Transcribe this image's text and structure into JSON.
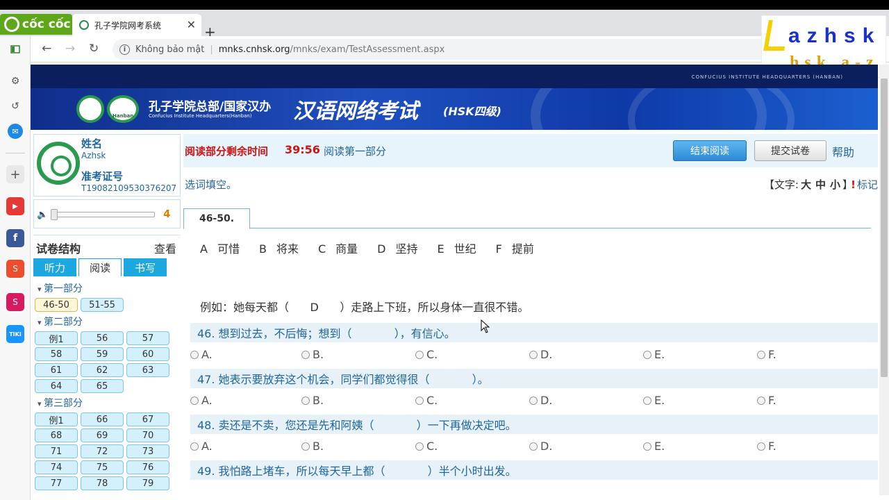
{
  "browser": {
    "brand": "cốc cốc",
    "tab_title": "孔子学院网考系统",
    "security_label": "Không bảo mật",
    "url_host": "mnks.cnhsk.org",
    "url_path": "/mnks/exam/TestAssessment.aspx"
  },
  "watermark": {
    "top": "azhsk",
    "bottom": "hsk a-z"
  },
  "banner": {
    "hq_text": "CONFUCIUS INSTITUTE HEADQUARTERS (HANBAN)",
    "hanban_label": "Hanban",
    "institute_name": "孔子学院总部/国家汉办",
    "institute_sub": "Confucius Institute Headquarters(Hanban)",
    "exam_title": "汉语网络考试",
    "exam_level": "(HSK四级)"
  },
  "candidate": {
    "name_label": "姓名",
    "name_value": "Azhsk",
    "id_label": "准考证号",
    "id_value": "T19082109530376207"
  },
  "volume": {
    "value": "4",
    "level": 0
  },
  "structure": {
    "title": "试卷结构",
    "view_label": "查看",
    "tabs": [
      "听力",
      "阅读",
      "书写"
    ],
    "sections": [
      {
        "label": "第一部分",
        "items": [
          "46-50",
          "51-55"
        ]
      },
      {
        "label": "第二部分",
        "items": [
          "例1",
          "56",
          "57",
          "58",
          "59",
          "60",
          "61",
          "62",
          "63",
          "64",
          "65"
        ]
      },
      {
        "label": "第三部分",
        "items": [
          "例1",
          "66",
          "67",
          "68",
          "69",
          "70",
          "71",
          "72",
          "73",
          "74",
          "75",
          "76",
          "77",
          "78",
          "79"
        ]
      }
    ]
  },
  "status": {
    "timer_label": "阅读部分剩余时间",
    "timer_value": "39:56",
    "part_label": "阅读第一部分",
    "end_button": "结束阅读",
    "submit_button": "提交试卷",
    "help": "帮助"
  },
  "instruction": "选词填空。",
  "font_size": {
    "prefix": "【文字:",
    "large": "大",
    "medium": "中",
    "small": "小",
    "suffix": "】"
  },
  "mark_label": "标记",
  "question_tab": "46-50.",
  "choices": [
    {
      "letter": "A",
      "word": "可惜"
    },
    {
      "letter": "B",
      "word": "将来"
    },
    {
      "letter": "C",
      "word": "商量"
    },
    {
      "letter": "D",
      "word": "坚持"
    },
    {
      "letter": "E",
      "word": "世纪"
    },
    {
      "letter": "F",
      "word": "提前"
    }
  ],
  "example": "例如：她每天都（      D      ）走路上下班，所以身体一直很不错。",
  "questions": [
    {
      "text": "46. 想到过去，不后悔；想到（            ），有信心。"
    },
    {
      "text": "47. 她表示要放弃这个机会，同学们都觉得很（            ）。"
    },
    {
      "text": "48. 卖还是不卖，您还是先和阿姨（            ）一下再做决定吧。"
    },
    {
      "text": "49. 我怕路上堵车，所以每天早上都（            ）半个小时出发。"
    }
  ],
  "option_labels": [
    "A.",
    "B.",
    "C.",
    "D.",
    "E.",
    "F."
  ]
}
